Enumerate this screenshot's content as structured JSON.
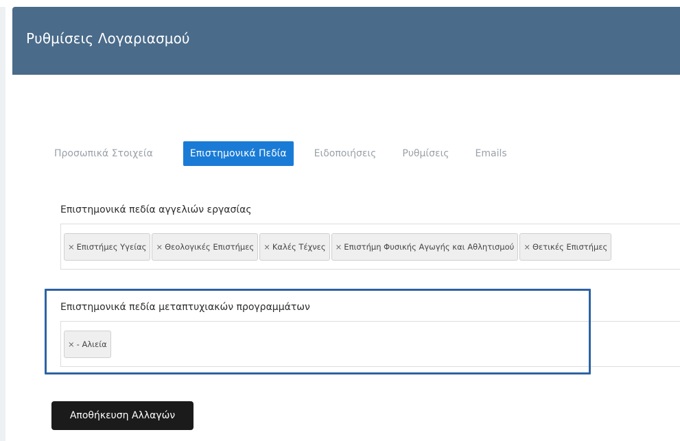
{
  "header": {
    "title": "Ρυθμίσεις Λογαριασμού"
  },
  "tabs": [
    {
      "label": "Προσωπικά Στοιχεία",
      "active": false
    },
    {
      "label": "Επιστημονικά Πεδία",
      "active": true
    },
    {
      "label": "Ειδοποιήσεις",
      "active": false
    },
    {
      "label": "Ρυθμίσεις",
      "active": false
    },
    {
      "label": "Emails",
      "active": false
    }
  ],
  "job_fields": {
    "label": "Επιστημονικά πεδία αγγελιών εργασίας",
    "tags": [
      {
        "remove": "×",
        "label": "Επιστήμες Υγείας"
      },
      {
        "remove": "×",
        "label": "Θεολογικές Επιστήμες"
      },
      {
        "remove": "×",
        "label": "Καλές Τέχνες"
      },
      {
        "remove": "×",
        "label": "Επιστήμη Φυσικής Αγωγής και Αθλητισμού"
      },
      {
        "remove": "×",
        "label": "Θετικές Επιστήμες"
      }
    ]
  },
  "postgrad_fields": {
    "label": "Επιστημονικά πεδία μεταπτυχιακών προγραμμάτων",
    "tags": [
      {
        "remove": "×",
        "label": "- Αλιεία"
      }
    ]
  },
  "actions": {
    "save_label": "Αποθήκευση Αλλαγών"
  },
  "colors": {
    "header_bg": "#4a6b8a",
    "active_tab": "#1a7bd6",
    "highlight_border": "#2d62a3",
    "save_button": "#1b1b1b"
  }
}
